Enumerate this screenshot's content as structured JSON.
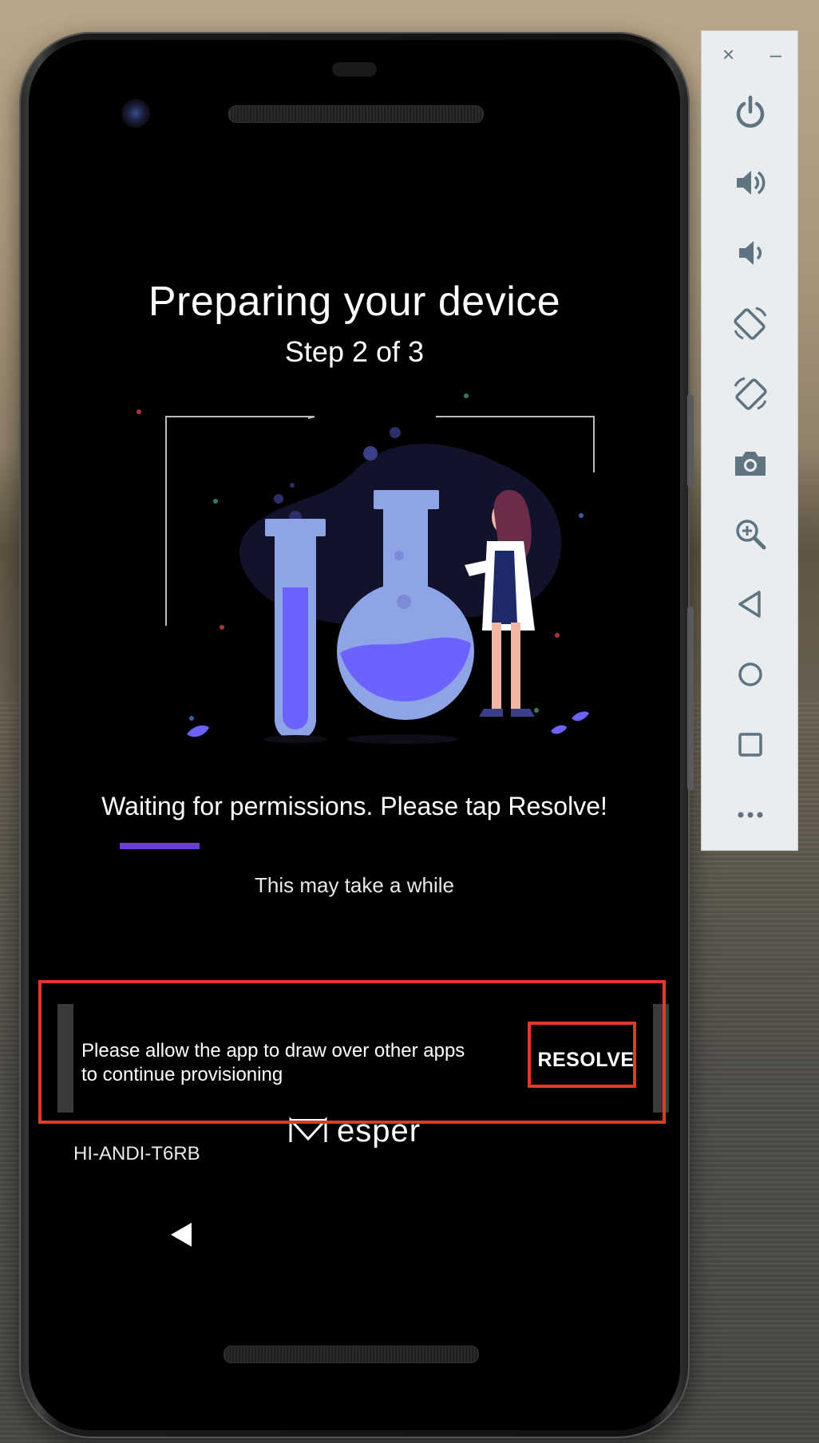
{
  "screen": {
    "title": "Preparing your device",
    "subtitle": "Step 2 of 3",
    "status_text": "Waiting for permissions. Please tap Resolve!",
    "progress": 0.17,
    "note": "This may take a while",
    "brand": "esper",
    "device_id": "HI-ANDI-T6RB"
  },
  "snackbar": {
    "message": "Please allow the app to draw over other apps to continue provisioning",
    "action_label": "RESOLVE"
  },
  "emulator_toolbar": {
    "close_label": "×",
    "minimize_label": "–",
    "buttons": [
      "power-icon",
      "volume-up-icon",
      "volume-down-icon",
      "rotate-left-icon",
      "rotate-right-icon",
      "camera-icon",
      "zoom-icon",
      "back-icon",
      "home-icon",
      "overview-icon",
      "more-icon"
    ]
  },
  "colors": {
    "accent": "#6a3fd4",
    "highlight": "#e03a2a",
    "toolbar_icon": "#5f7380"
  }
}
